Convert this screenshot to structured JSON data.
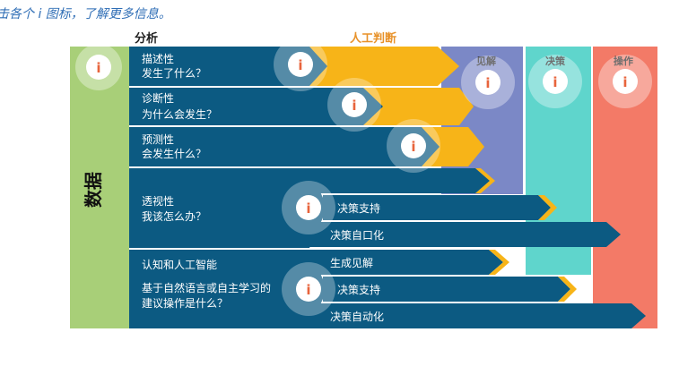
{
  "intro": "击各个 i 图标，了解更多信息。",
  "header": {
    "analysis": "分析",
    "human_judgment": "人工判断"
  },
  "columns": {
    "data": "数据",
    "insight": "见解",
    "decision": "决策",
    "action": "操作"
  },
  "rows": [
    {
      "title": "描述性",
      "question": "发生了什么？"
    },
    {
      "title": "诊断性",
      "question": "为什么会发生？"
    },
    {
      "title": "预测性",
      "question": "会发生什么？"
    },
    {
      "title": "透视性",
      "question": "我该怎么办？"
    },
    {
      "title": "认知和人工智能",
      "question_line1": "基于自然语言或自主学习的",
      "question_line2": "建议操作是什么？"
    }
  ],
  "arrows": {
    "decision_support": "决策支持",
    "decision_automation_partial": "决策自口化",
    "generate_insight": "生成见解",
    "decision_support_2": "决策支持",
    "decision_automation": "决策自动化"
  },
  "info_glyph": "i",
  "colors": {
    "data_green": "#a8cf78",
    "analysis_blue": "#0c5a82",
    "human_yellow": "#f7b418",
    "insight_purple": "#7b88c6",
    "decision_teal": "#5fd5cc",
    "action_coral": "#f37a67",
    "header_orange": "#e8922a",
    "info_red": "#e8643c"
  }
}
